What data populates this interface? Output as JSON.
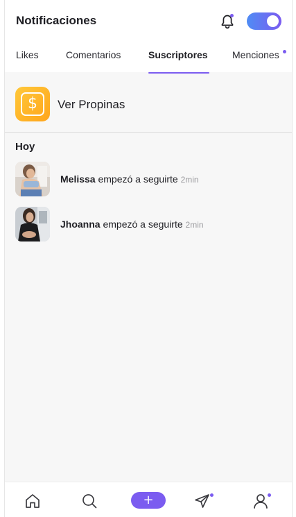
{
  "colors": {
    "accent": "#7b5cf0",
    "toggle_start": "#4f8cf4",
    "toggle_end": "#7b5cf0",
    "coin": "#ffb21f"
  },
  "header": {
    "title": "Notificaciones",
    "bell_icon": "bell-icon",
    "toggle_on": true
  },
  "tabs": [
    {
      "label": "Likes",
      "active": false
    },
    {
      "label": "Comentarios",
      "active": false
    },
    {
      "label": "Suscriptores",
      "active": true
    },
    {
      "label": "Menciones",
      "active": false,
      "has_dot": true
    }
  ],
  "tips": {
    "icon": "dollar-coin-icon",
    "symbol": "$",
    "label": "Ver Propinas"
  },
  "section": {
    "title": "Hoy"
  },
  "notifications": [
    {
      "name": "Melissa",
      "text": "empezó a seguirte",
      "time": "2min"
    },
    {
      "name": "Jhoanna",
      "text": "empezó a seguirte",
      "time": "2min"
    }
  ],
  "bottom_nav": {
    "items": [
      "home-icon",
      "search-icon",
      "add-icon",
      "send-icon",
      "profile-icon"
    ],
    "add_symbol": "+"
  }
}
